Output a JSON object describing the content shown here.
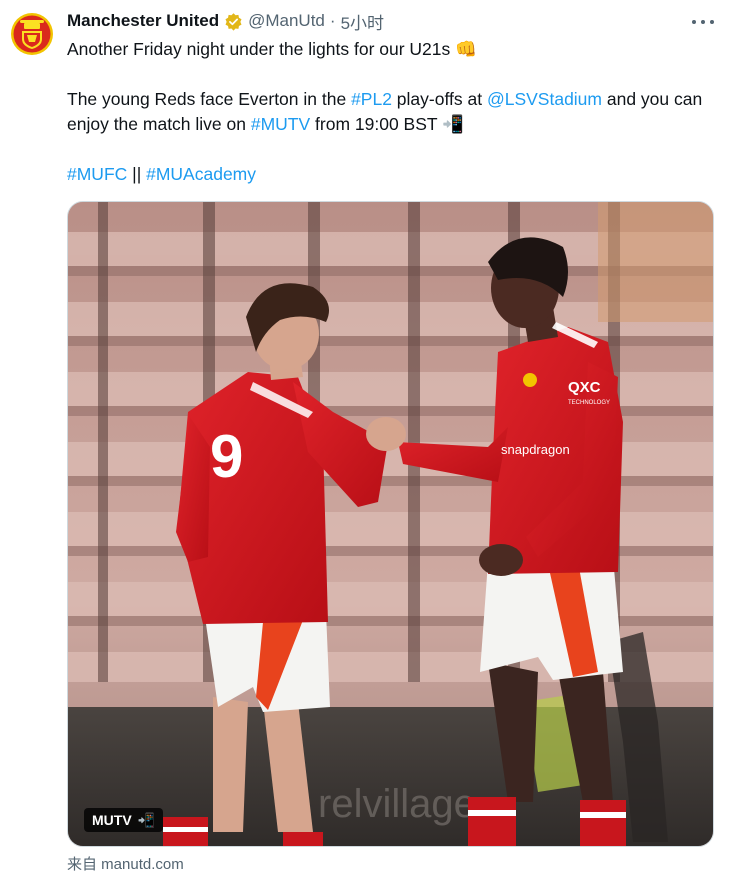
{
  "post": {
    "author_name": "Manchester United",
    "author_handle": "@ManUtd",
    "separator": "·",
    "timestamp": "5小时",
    "text_line1": "Another Friday night under the lights for our U21s",
    "emoji_fist": "👊",
    "text_p2_a": "The young Reds face Everton in the ",
    "hashtag_pl2": "#PL2",
    "text_p2_b": " play-offs at ",
    "mention_stadium": "@LSVStadium",
    "text_p2_c": " and you can enjoy the match live on ",
    "hashtag_mutv": "#MUTV",
    "text_p2_d": " from 19:00 BST ",
    "emoji_phone": "📲",
    "hashtag_mufc": "#MUFC",
    "tags_separator": " || ",
    "hashtag_muacademy": "#MUAcademy"
  },
  "media": {
    "badge_label": "MUTV",
    "badge_emoji": "📲",
    "jersey_number": "9",
    "sponsor_text": "snapdragon",
    "sleeve_sponsor": "QXC",
    "sleeve_sub": "TECHNOLOGY",
    "hoarding_text": "relvillage"
  },
  "source": {
    "label": "来自 manutd.com"
  },
  "colors": {
    "link": "#1d9bf0",
    "verified_gold": "#e2b719",
    "kit_red": "#d4151b",
    "seat_pink": "#c9a49d"
  }
}
